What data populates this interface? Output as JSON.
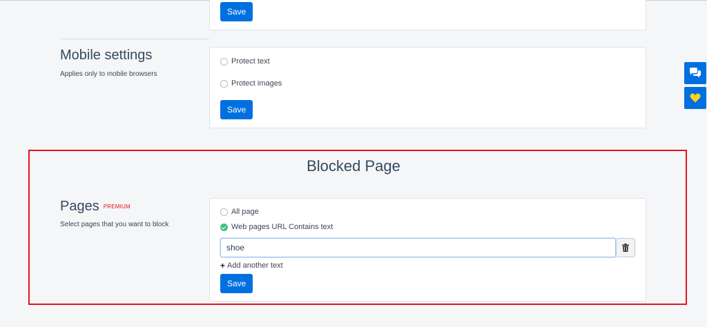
{
  "top_card": {
    "save_label": "Save"
  },
  "mobile": {
    "title": "Mobile settings",
    "description": "Applies only to mobile browsers",
    "options": [
      "Protect text",
      "Protect images"
    ],
    "save_label": "Save"
  },
  "blocked": {
    "title": "Blocked Page",
    "pages_title": "Pages",
    "premium_badge": "PREMIUM",
    "description": "Select pages that you want to block",
    "options": [
      "All page",
      "Web pages URL Contains text"
    ],
    "selected_option": "Web pages URL Contains text",
    "url_input_value": "shoe",
    "add_text_label": "Add another text",
    "save_label": "Save"
  },
  "side_buttons": [
    "chat-icon",
    "heart-icon"
  ],
  "colors": {
    "primary": "#0070e0",
    "highlight": "#e2141d",
    "check": "#3cc480",
    "heart": "#ffd21f"
  }
}
